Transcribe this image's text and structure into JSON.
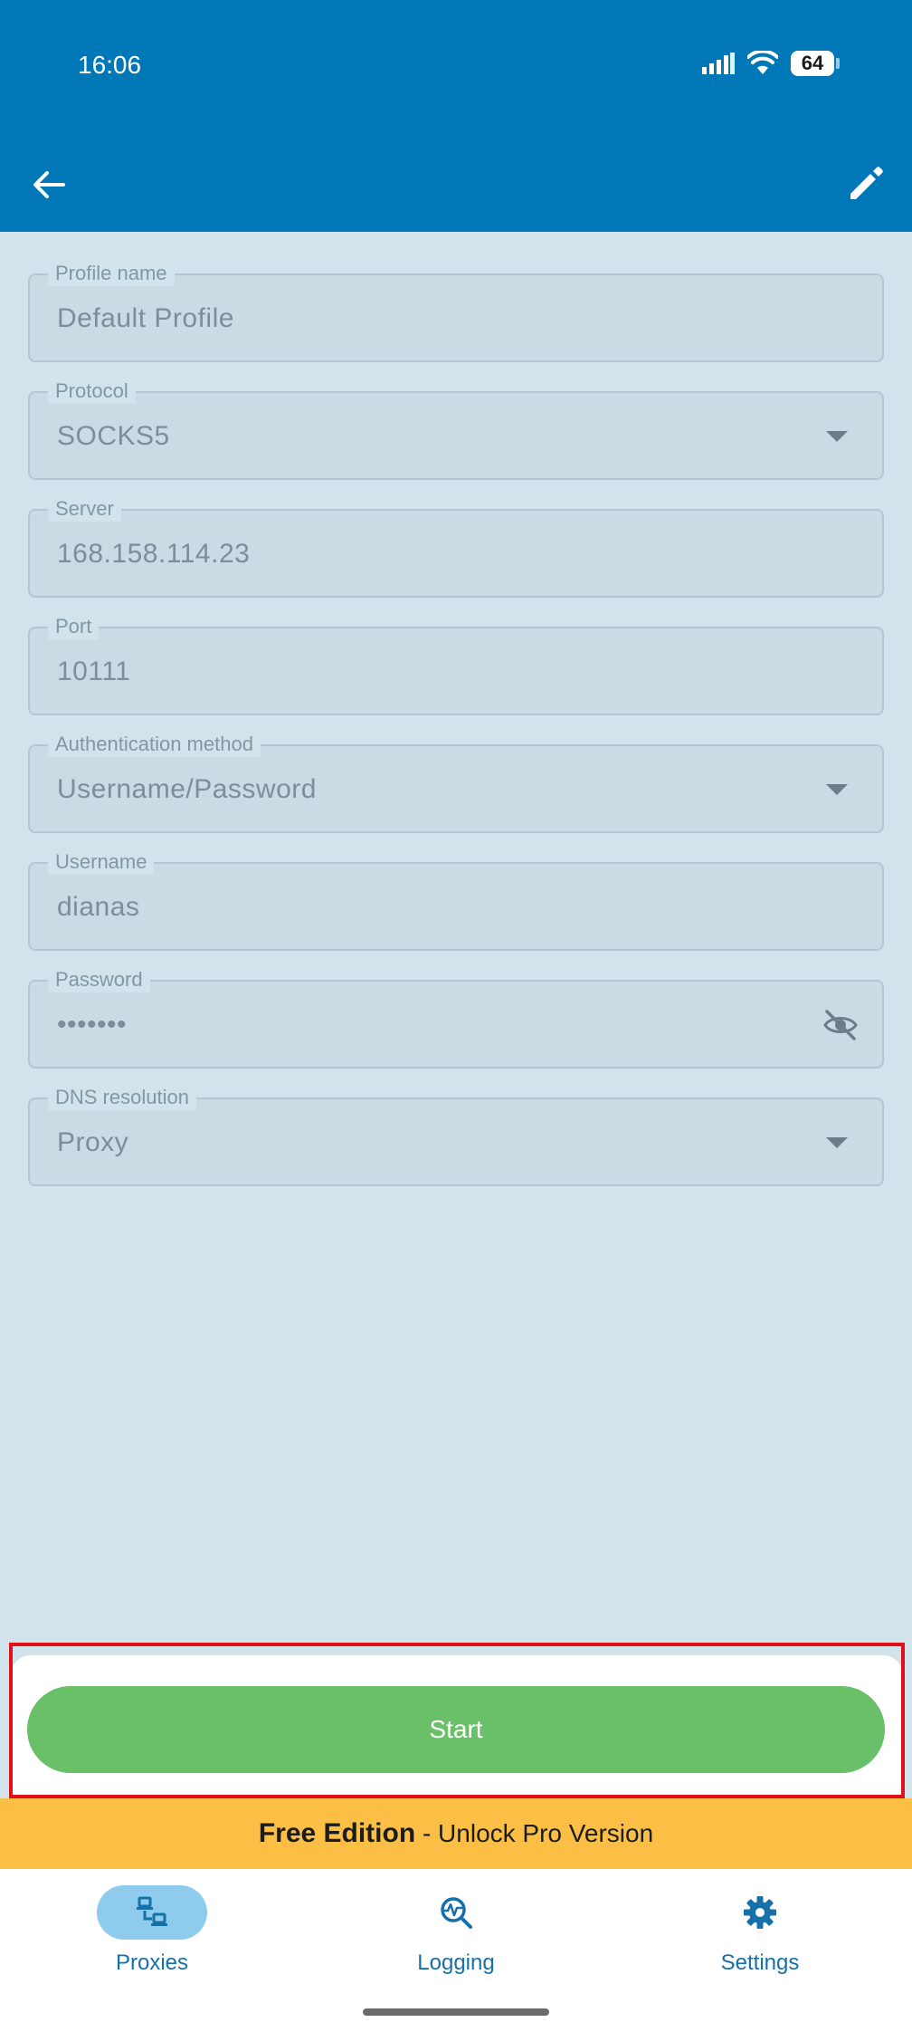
{
  "status_bar": {
    "time": "16:06",
    "battery": "64"
  },
  "colors": {
    "app_bar": "#0077b6",
    "background": "#d2e3ec",
    "start_button": "#6abf69",
    "promo_banner": "#fbbf45",
    "nav_active": "#8fcbec",
    "highlight": "#e0101b"
  },
  "header": {
    "back_icon": "arrow-left-icon",
    "edit_icon": "pencil-icon"
  },
  "form": {
    "profile_name": {
      "label": "Profile name",
      "value": "Default Profile"
    },
    "protocol": {
      "label": "Protocol",
      "value": "SOCKS5"
    },
    "server": {
      "label": "Server",
      "value": "168.158.114.23"
    },
    "port": {
      "label": "Port",
      "value": "10111"
    },
    "auth_method": {
      "label": "Authentication method",
      "value": "Username/Password"
    },
    "username": {
      "label": "Username",
      "value": "dianas"
    },
    "password": {
      "label": "Password",
      "value": "•••••••"
    },
    "dns_resolution": {
      "label": "DNS resolution",
      "value": "Proxy"
    }
  },
  "actions": {
    "start_label": "Start"
  },
  "promo": {
    "strong": "Free Edition",
    "rest": " - Unlock Pro Version"
  },
  "bottom_nav": {
    "items": [
      {
        "label": "Proxies",
        "icon": "network-devices-icon",
        "active": true
      },
      {
        "label": "Logging",
        "icon": "activity-search-icon",
        "active": false
      },
      {
        "label": "Settings",
        "icon": "gear-icon",
        "active": false
      }
    ]
  }
}
